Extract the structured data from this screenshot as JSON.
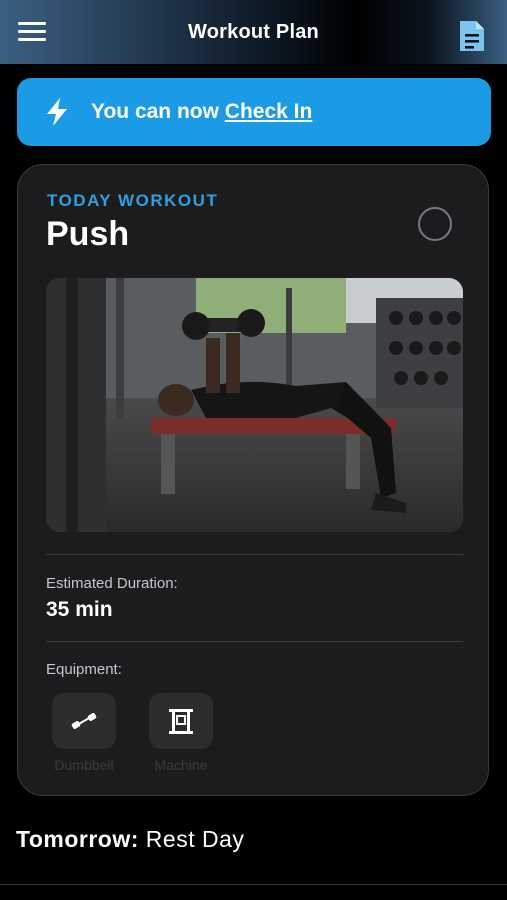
{
  "header": {
    "title": "Workout Plan",
    "menu_icon": "hamburger-menu-icon",
    "doc_icon": "document-icon"
  },
  "banner": {
    "prefix": "You can now ",
    "link": "Check In",
    "icon": "lightning-bolt-icon",
    "color": "#1b9be6"
  },
  "workout": {
    "kicker": "TODAY WORKOUT",
    "name": "Push",
    "completed": false,
    "duration_label": "Estimated Duration:",
    "duration_value": "35 min",
    "equipment_label": "Equipment:",
    "equipment": [
      {
        "label": "Dumbbell",
        "icon": "dumbbell-icon"
      },
      {
        "label": "Machine",
        "icon": "machine-icon"
      }
    ]
  },
  "tomorrow": {
    "label": "Tomorrow:",
    "value": "Rest Day"
  },
  "colors": {
    "accent": "#2f9fe0",
    "card": "#1c1c1e",
    "background": "#000000"
  }
}
